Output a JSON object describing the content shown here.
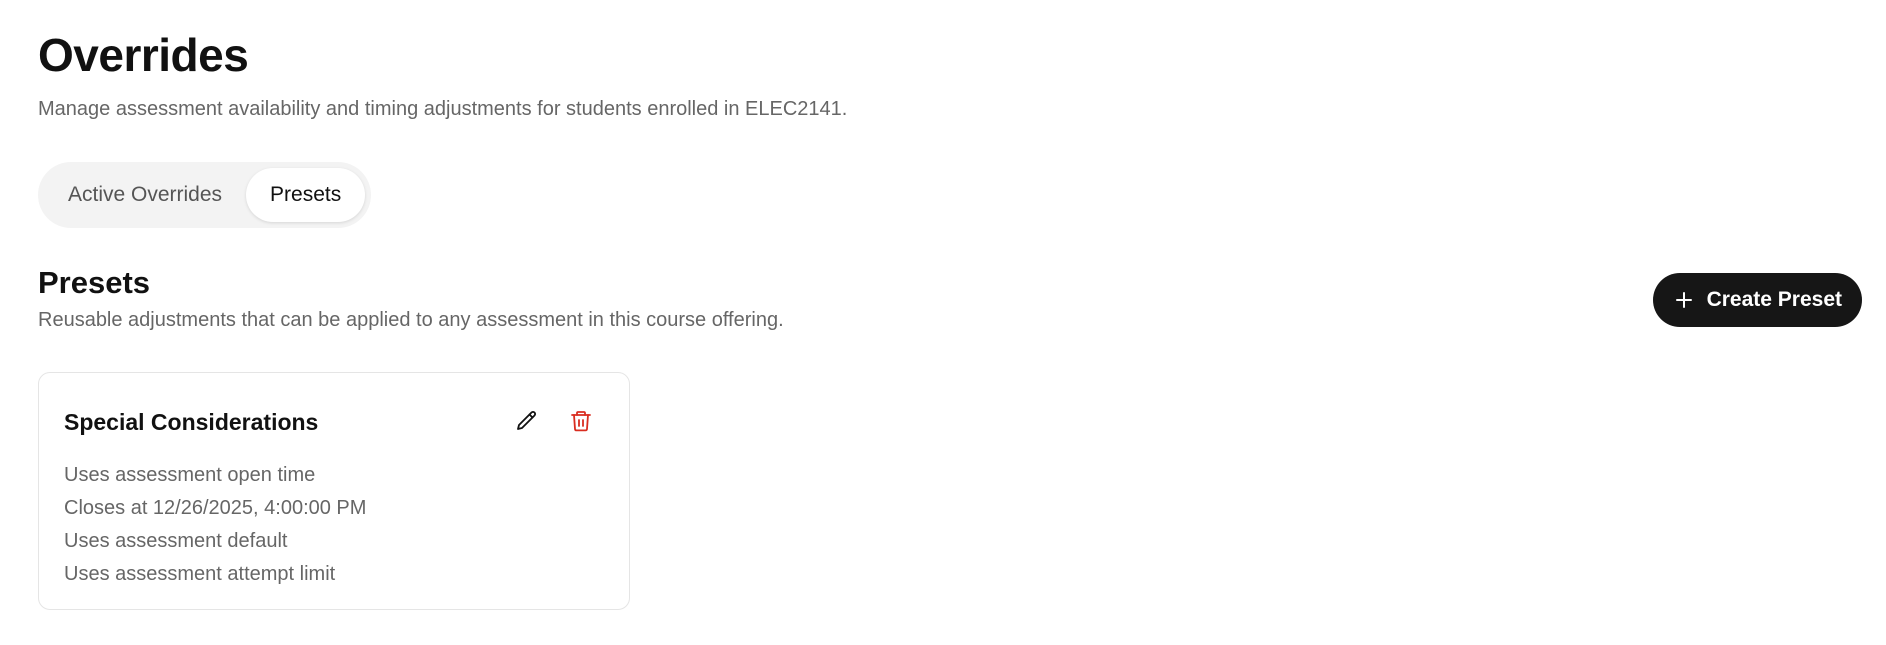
{
  "header": {
    "title": "Overrides",
    "subtitle": "Manage assessment availability and timing adjustments for students enrolled in ELEC2141."
  },
  "tabs": [
    {
      "label": "Active Overrides",
      "active": false
    },
    {
      "label": "Presets",
      "active": true
    }
  ],
  "presets_section": {
    "title": "Presets",
    "subtitle": "Reusable adjustments that can be applied to any assessment in this course offering.",
    "create_button_label": "Create Preset",
    "create_button_icon": "plus-icon"
  },
  "preset_cards": [
    {
      "title": "Special Considerations",
      "edit_icon": "pencil-icon",
      "delete_icon": "trash-icon",
      "lines": [
        "Uses assessment open time",
        "Closes at 12/26/2025, 4:00:00 PM",
        "Uses assessment default",
        "Uses assessment attempt limit"
      ]
    }
  ],
  "colors": {
    "primary_button": "#161616",
    "delete": "#d92d20",
    "muted_text": "#666666",
    "tab_track": "#f3f3f3"
  }
}
